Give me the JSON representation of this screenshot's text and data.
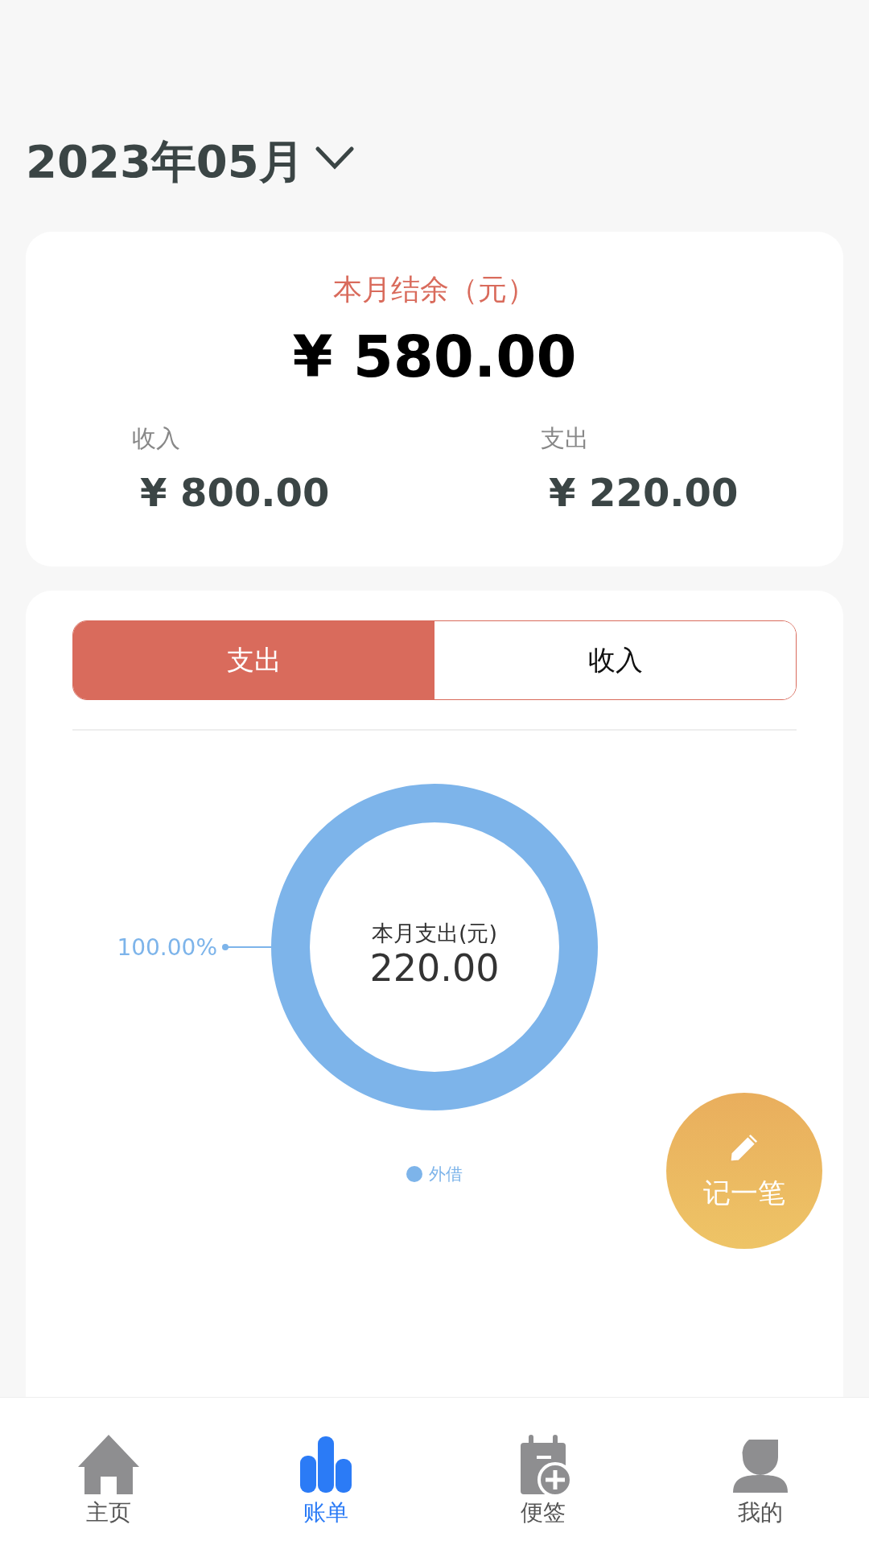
{
  "header": {
    "month": "2023年05月"
  },
  "summary": {
    "label": "本月结余（元）",
    "balance": "¥ 580.00",
    "items": [
      {
        "label": "收入",
        "amount": "¥ 800.00"
      },
      {
        "label": "支出",
        "amount": "¥ 220.00"
      }
    ]
  },
  "tabs": [
    {
      "label": "支出",
      "selected": true
    },
    {
      "label": "收入",
      "selected": false
    }
  ],
  "chart": {
    "center_label": "本月支出(元)",
    "center_value": "220.00",
    "chart_data": {
      "type": "pie",
      "categories": [
        "外借"
      ],
      "series": [
        {
          "color": "#7db4ea",
          "values": [
            100
          ]
        }
      ],
      "value_labels": [
        "100.00%"
      ]
    }
  },
  "fab": {
    "label": "记一笔"
  },
  "nav": [
    {
      "label": "主页",
      "kind": "home",
      "selected": false
    },
    {
      "label": "账单",
      "kind": "bars",
      "selected": true
    },
    {
      "label": "便签",
      "kind": "calendar",
      "selected": false
    },
    {
      "label": "我的",
      "kind": "person",
      "selected": false
    }
  ]
}
